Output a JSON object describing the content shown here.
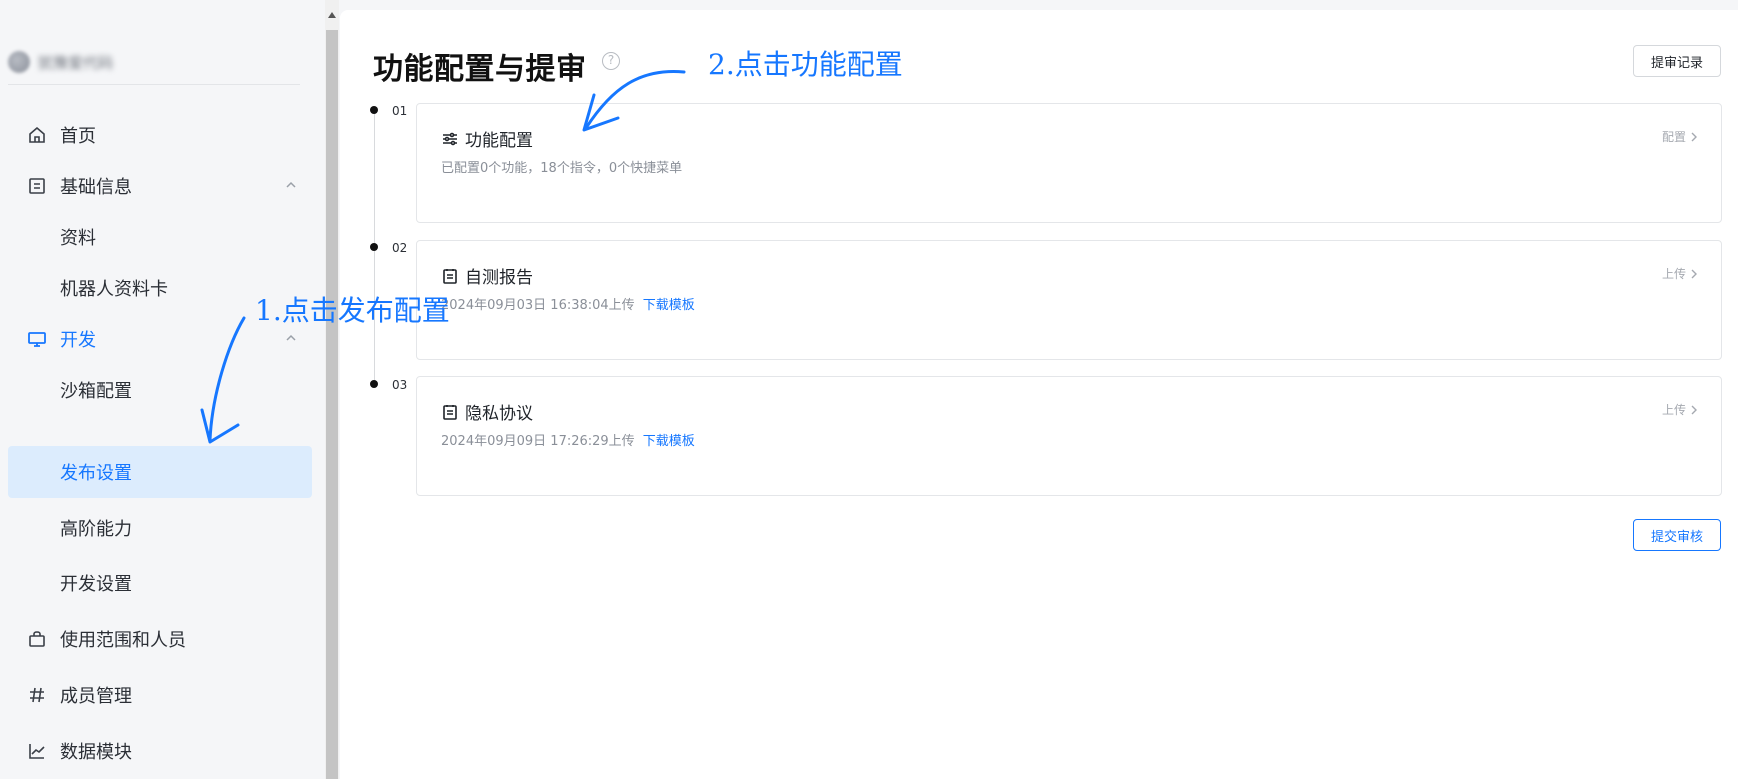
{
  "sidebar": {
    "brand_name": "犹豫爱代码",
    "items": [
      {
        "label": "首页",
        "icon": "home-icon"
      },
      {
        "label": "基础信息",
        "icon": "document-icon",
        "expanded": true
      },
      {
        "label": "资料"
      },
      {
        "label": "机器人资料卡"
      },
      {
        "label": "开发",
        "icon": "monitor-icon",
        "expanded": true
      },
      {
        "label": "沙箱配置"
      },
      {
        "label": "发布设置",
        "active": true
      },
      {
        "label": "高阶能力"
      },
      {
        "label": "开发设置"
      },
      {
        "label": "使用范围和人员",
        "icon": "bag-icon"
      },
      {
        "label": "成员管理",
        "icon": "hash-icon"
      },
      {
        "label": "数据模块",
        "icon": "chart-line-icon"
      }
    ]
  },
  "main": {
    "title": "功能配置与提审",
    "records_button": "提审记录",
    "submit_button": "提交审核",
    "steps": [
      {
        "num": "01",
        "title": "功能配置",
        "icon": "sliders-icon",
        "subtitle": "已配置0个功能，18个指令，0个快捷菜单",
        "action": "配置"
      },
      {
        "num": "02",
        "title": "自测报告",
        "icon": "clipboard-icon",
        "subtitle": "2024年09月03日 16:38:04上传",
        "link": "下载模板",
        "action": "上传"
      },
      {
        "num": "03",
        "title": "隐私协议",
        "icon": "clipboard-icon",
        "subtitle": "2024年09月09日 17:26:29上传",
        "link": "下载模板",
        "action": "上传"
      }
    ]
  },
  "annotations": {
    "step1": "1.点击发布配置",
    "step2": "2.点击功能配置"
  },
  "colors": {
    "accent": "#1677ff",
    "active_bg": "#dcecfd",
    "sidebar_bg": "#f5f6f8"
  }
}
